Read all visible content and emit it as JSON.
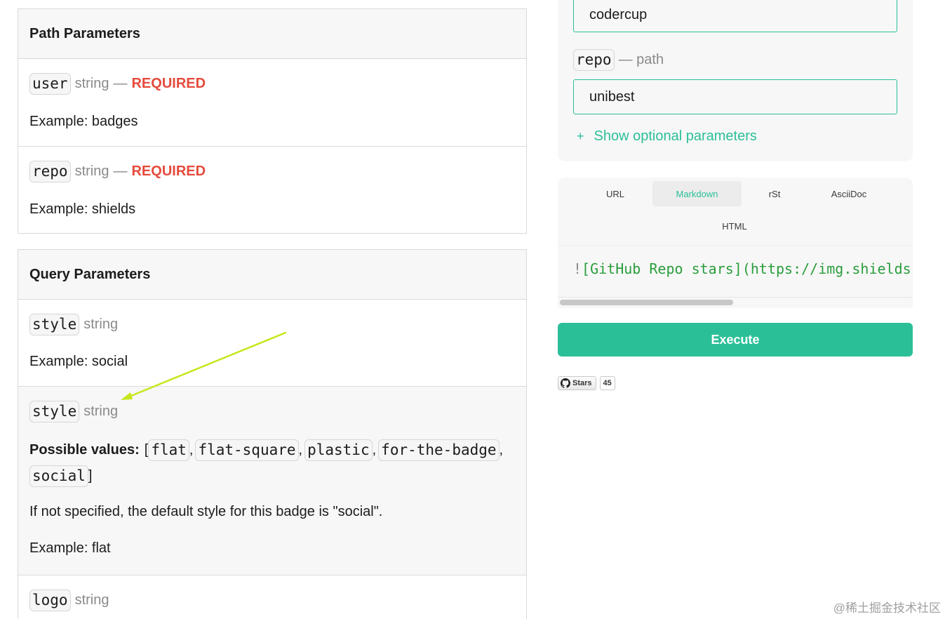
{
  "path_parameters": {
    "title": "Path Parameters",
    "params": [
      {
        "name": "user",
        "type": "string",
        "dash": "—",
        "required": "REQUIRED",
        "example": "Example: badges"
      },
      {
        "name": "repo",
        "type": "string",
        "dash": "—",
        "required": "REQUIRED",
        "example": "Example: shields"
      }
    ]
  },
  "query_parameters": {
    "title": "Query Parameters",
    "params": [
      {
        "name": "style",
        "type": "string",
        "example": "Example: social"
      },
      {
        "name": "style",
        "type": "string",
        "possible_label": "Possible values:",
        "possible_values": [
          "flat",
          "flat-square",
          "plastic",
          "for-the-badge",
          "social"
        ],
        "default_note": "If not specified, the default style for this badge is \"social\".",
        "example": "Example: flat"
      },
      {
        "name": "logo",
        "type": "string"
      }
    ]
  },
  "form": {
    "user_value": "codercup",
    "repo_label": "repo",
    "repo_kind": "— path",
    "repo_value": "unibest",
    "optional_toggle": "Show optional parameters",
    "optional_icon": "plus-icon"
  },
  "snippet": {
    "tabs": [
      "URL",
      "Markdown",
      "rSt",
      "AsciiDoc",
      "HTML"
    ],
    "active_tab": "Markdown",
    "code_bang": "!",
    "code_rest": "[GitHub Repo stars](https://img.shields.io/github/stars/codercup/unibest?style=social)"
  },
  "execute_label": "Execute",
  "badge": {
    "label": "Stars",
    "count": "45",
    "icon": "github-icon"
  },
  "annotation": {
    "arrow_color": "#c8e61c"
  },
  "watermark": "@稀土掘金技术社区",
  "colors": {
    "accent": "#2bbf98",
    "required": "#e54b3c",
    "muted": "#8a8a8a"
  }
}
